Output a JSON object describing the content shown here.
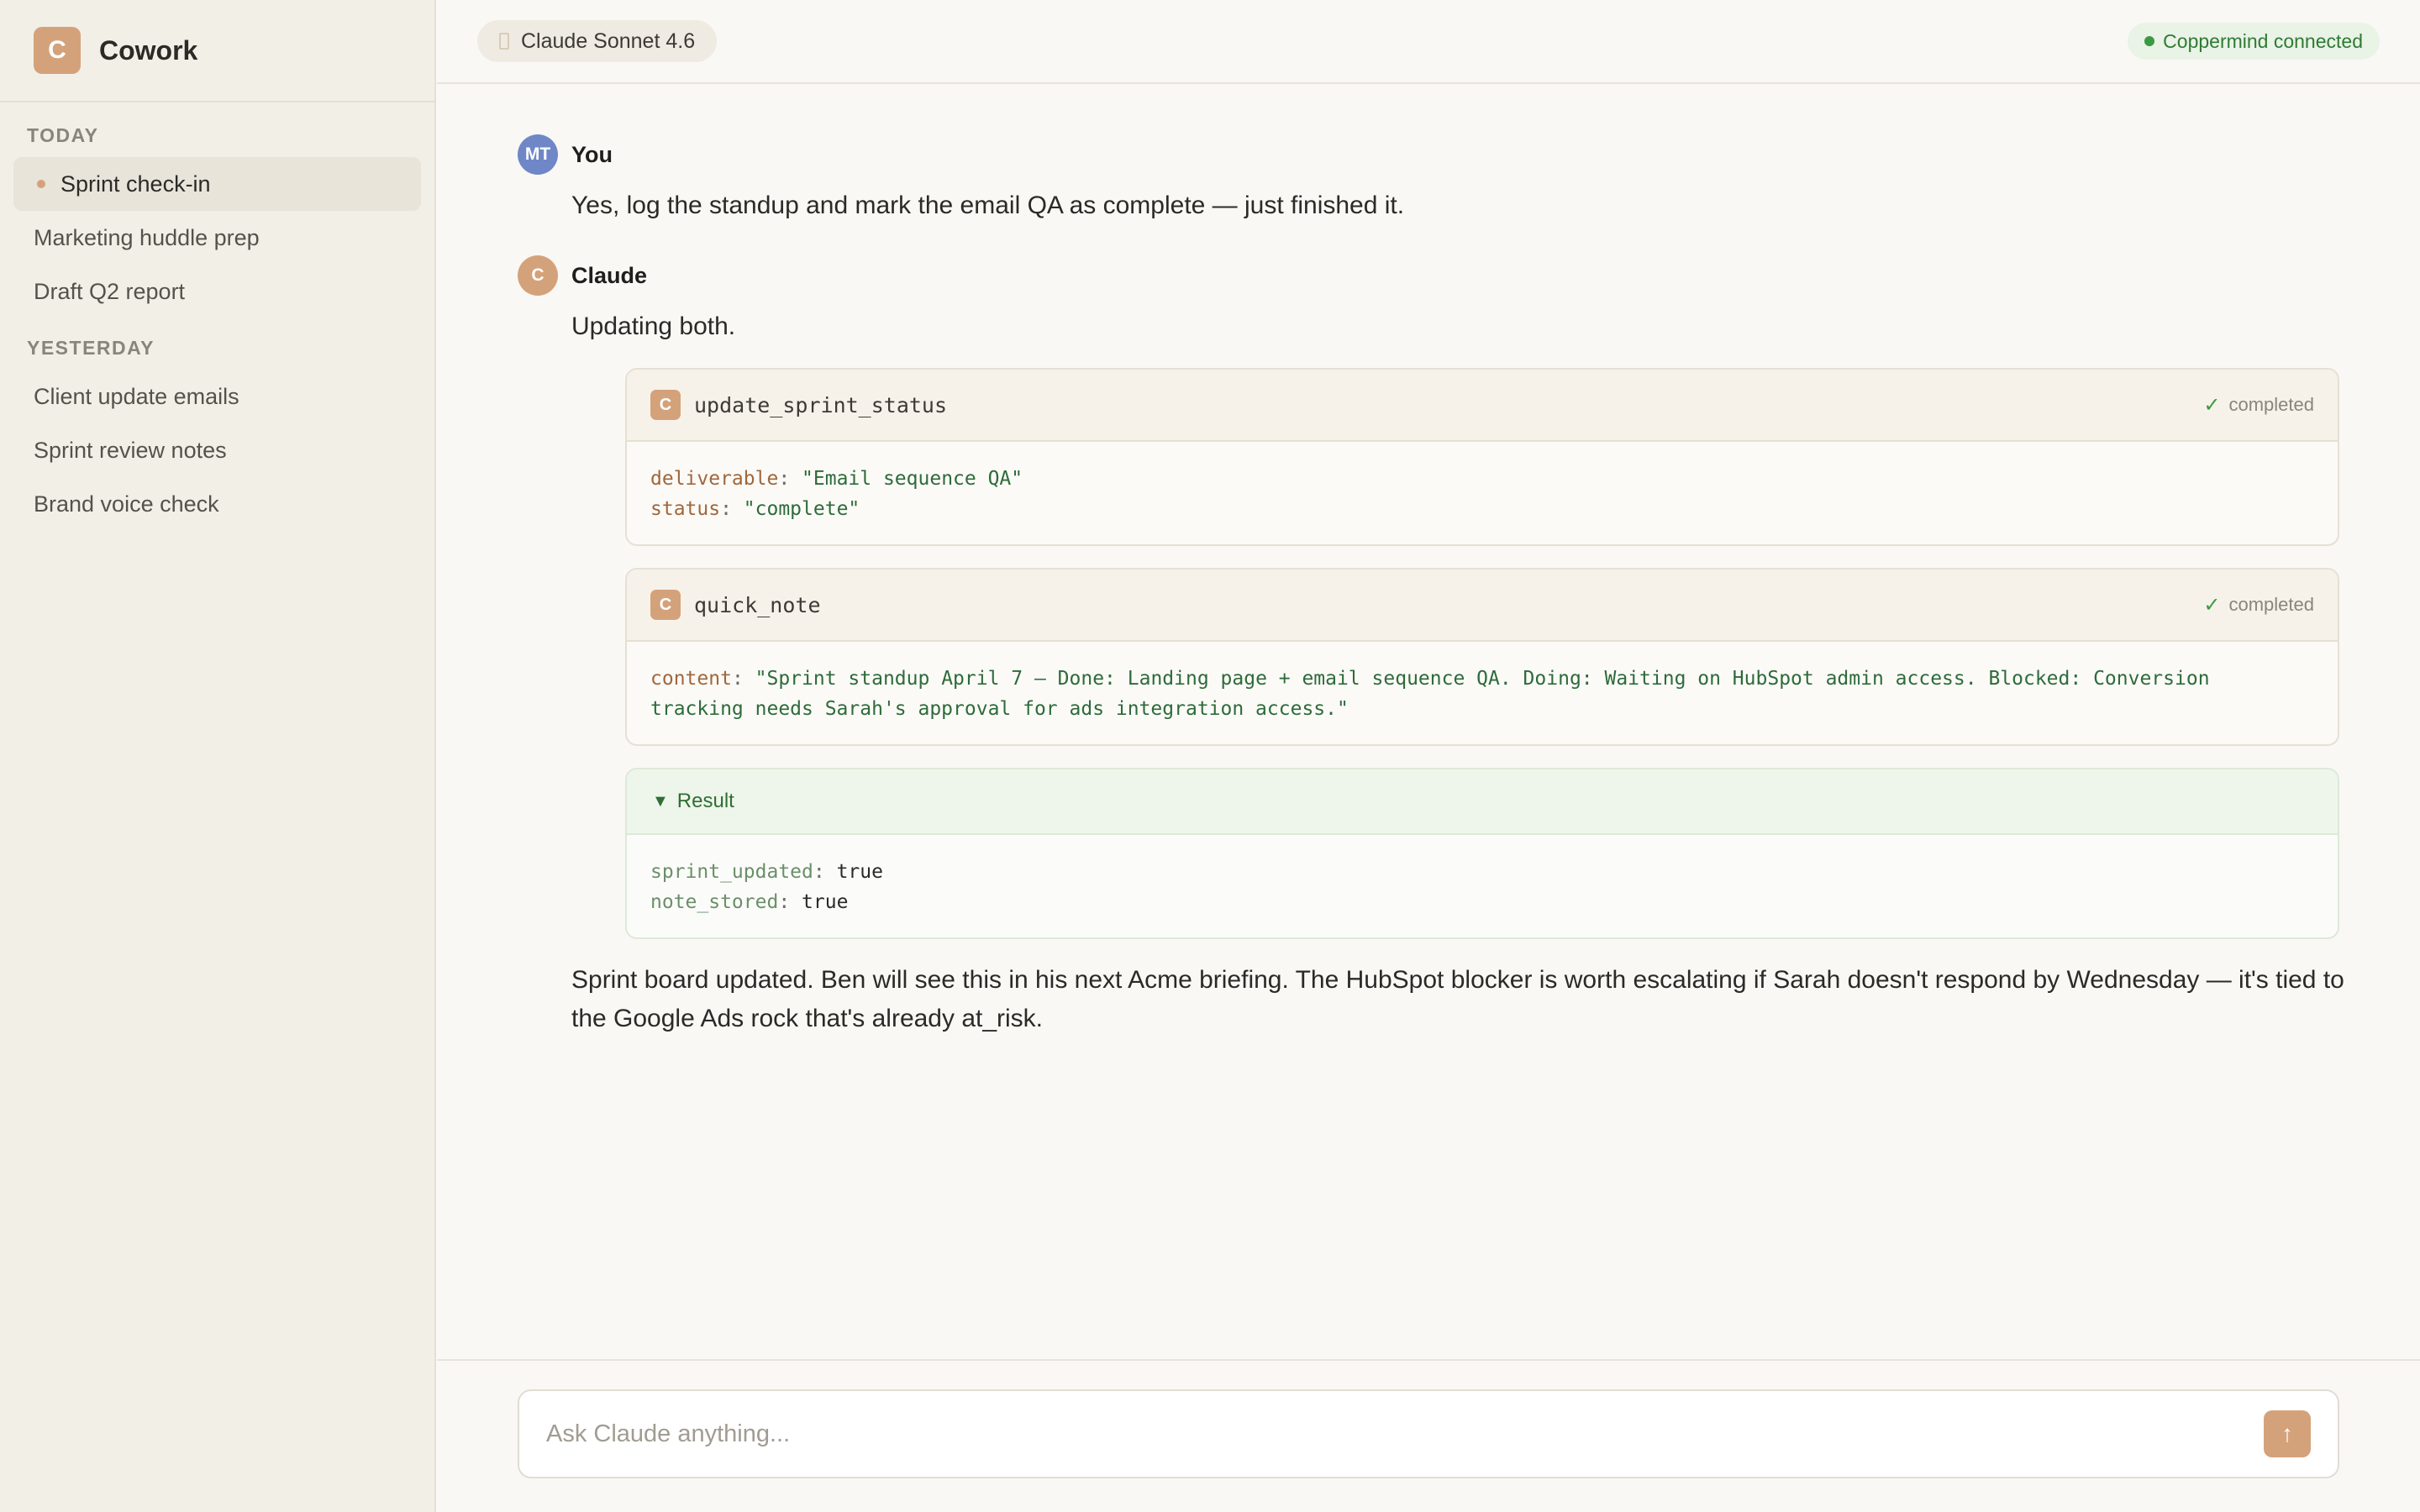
{
  "app": {
    "name": "Cowork",
    "logo_letter": "C"
  },
  "sidebar": {
    "today_label": "TODAY",
    "today": [
      {
        "label": "Sprint check-in",
        "active": true
      },
      {
        "label": "Marketing huddle prep"
      },
      {
        "label": "Draft Q2 report"
      }
    ],
    "yesterday_label": "YESTERDAY",
    "yesterday": [
      {
        "label": "Client update emails"
      },
      {
        "label": "Sprint review notes"
      },
      {
        "label": "Brand voice check"
      }
    ]
  },
  "header": {
    "model_label": "Claude Sonnet 4.6",
    "connection_status": "Coppermind connected"
  },
  "messages": {
    "user": {
      "initials": "MT",
      "author": "You",
      "text": "Yes, log the standup and mark the email QA as complete — just finished it."
    },
    "assistant": {
      "initials": "C",
      "author": "Claude",
      "intro": "Updating both.",
      "tool_calls": [
        {
          "icon_letter": "C",
          "name": "update_sprint_status",
          "status": "completed",
          "args": [
            {
              "key": "deliverable",
              "value": "\"Email sequence QA\""
            },
            {
              "key": "status",
              "value": "\"complete\""
            }
          ]
        },
        {
          "icon_letter": "C",
          "name": "quick_note",
          "status": "completed",
          "args": [
            {
              "key": "content",
              "value": "\"Sprint standup April 7 — Done: Landing page + email sequence QA. Doing: Waiting on HubSpot admin access. Blocked: Conversion tracking needs Sarah's approval for ads integration access.\""
            }
          ]
        }
      ],
      "result": {
        "label": "Result",
        "fields": [
          {
            "key": "sprint_updated",
            "value": "true"
          },
          {
            "key": "note_stored",
            "value": "true"
          }
        ]
      },
      "conclusion": "Sprint board updated. Ben will see this in his next Acme briefing. The HubSpot blocker is worth escalating if Sarah doesn't respond by Wednesday — it's tied to the Google Ads rock that's already at_risk."
    }
  },
  "composer": {
    "placeholder": "Ask Claude anything..."
  },
  "icons": {
    "check": "✓",
    "caret": "▼",
    "send": "↑"
  },
  "colors": {
    "accent": "#d4a27a",
    "user_avatar": "#6f87c7",
    "success": "#3a9a42"
  }
}
